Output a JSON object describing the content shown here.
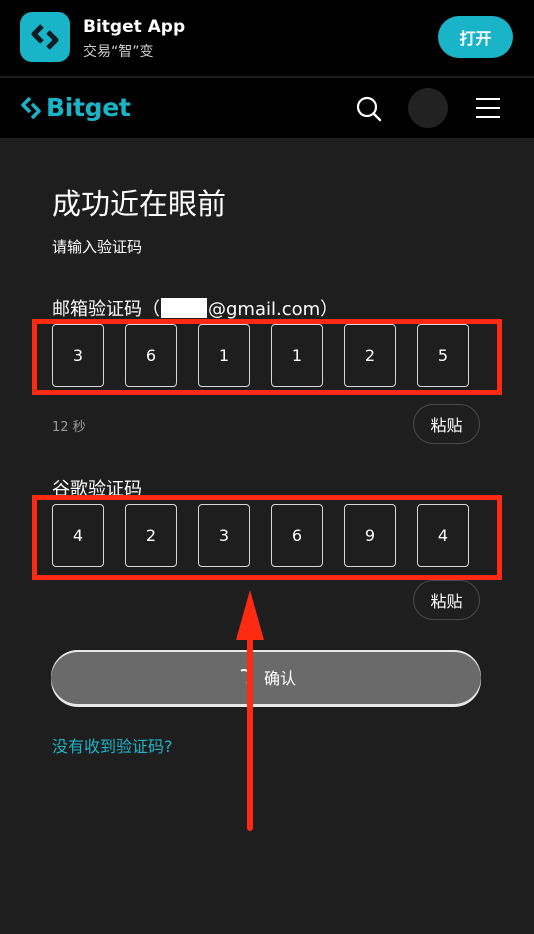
{
  "banner": {
    "app_title": "Bitget App",
    "app_subtitle": "交易“智”变",
    "open_label": "打开"
  },
  "header": {
    "logo_text": "Bitget"
  },
  "main": {
    "headline": "成功近在眼前",
    "subline": "请输入验证码",
    "email_label_prefix": "邮箱验证码（",
    "email_label_suffix": "@gmail.com）",
    "email_code": [
      "3",
      "6",
      "1",
      "1",
      "2",
      "5"
    ],
    "timer_text": "12 秒",
    "paste_label": "粘贴",
    "google_label": "谷歌验证码",
    "google_code": [
      "4",
      "2",
      "3",
      "6",
      "9",
      "4"
    ],
    "confirm_label": "确认",
    "resend_label": "没有收到验证码?"
  },
  "colors": {
    "accent": "#1ab4c8",
    "highlight": "#ff2a12",
    "panel": "#1e1e1e"
  },
  "icons": [
    "bitget-logo-icon",
    "search-icon",
    "menu-icon",
    "spinner-icon",
    "annotation-arrow"
  ]
}
